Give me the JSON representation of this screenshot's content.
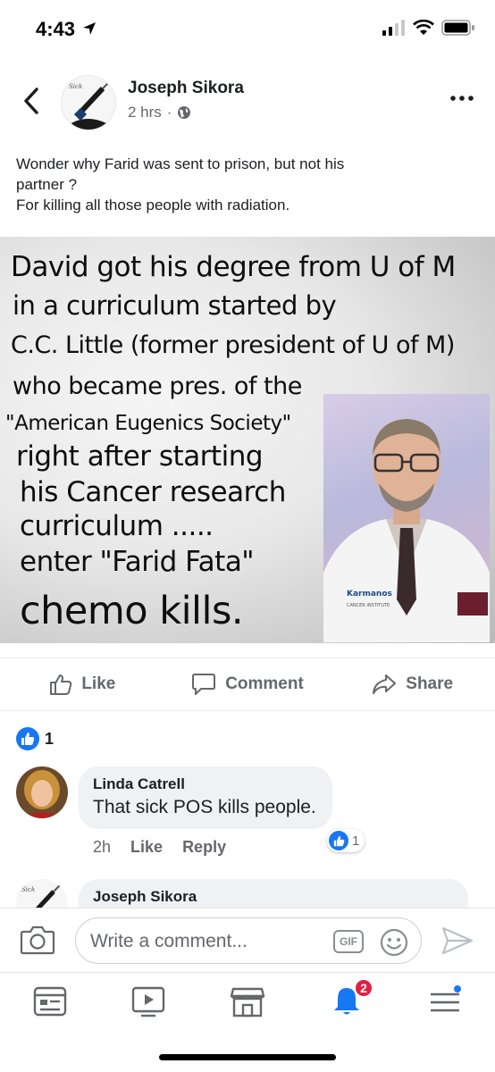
{
  "status_bar": {
    "time": "4:43"
  },
  "post": {
    "author": "Joseph Sikora",
    "time": "2 hrs",
    "text_lines": [
      "Wonder why Farid was sent to prison, but not his",
      "partner ?",
      "For killing all those people with radiation."
    ],
    "image": {
      "lines": [
        "David got his degree from U of M",
        "in a curriculum started by",
        "C.C. Little (former president of U of M)",
        "who became pres. of the",
        "\"American Eugenics Society\"",
        "right after starting",
        "his Cancer research",
        "curriculum  .....",
        "enter \"Farid Fata\"",
        "chemo kills."
      ]
    }
  },
  "actions": {
    "like": "Like",
    "comment": "Comment",
    "share": "Share"
  },
  "reactions": {
    "count": "1"
  },
  "comments": [
    {
      "author": "Linda Catrell",
      "text": "That sick POS kills people.",
      "time": "2h",
      "like_label": "Like",
      "reply_label": "Reply",
      "reaction_count": "1"
    },
    {
      "author": "Joseph Sikora"
    }
  ],
  "composer": {
    "placeholder": "Write a comment...",
    "gif_label": "GIF"
  },
  "tab_bar": {
    "notification_count": "2"
  },
  "colors": {
    "facebook_blue": "#1877f2",
    "badge_red": "#e41e3f",
    "muted": "#65676b"
  },
  "icons": [
    "location-arrow-icon",
    "signal-icon",
    "wifi-icon",
    "battery-icon",
    "back-chevron-icon",
    "more-icon",
    "globe-icon",
    "thumbs-up-icon",
    "comment-icon",
    "share-icon",
    "camera-icon",
    "emoji-icon",
    "send-icon",
    "news-feed-icon",
    "watch-icon",
    "marketplace-icon",
    "bell-icon",
    "menu-icon"
  ]
}
